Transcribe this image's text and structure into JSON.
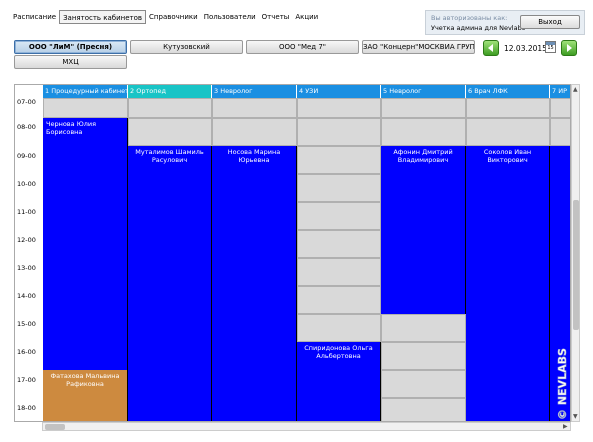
{
  "menu": {
    "items": [
      "Расписание",
      "Занятость кабинетов",
      "Справочники",
      "Пользователи",
      "Отчеты",
      "Акции"
    ]
  },
  "auth": {
    "line1": "Вы авторизованы как:",
    "line2": "Учетка админа для Nevlabs",
    "logout_label": "Выход"
  },
  "branches": {
    "selected": "ООО \"ЛиМ\" (Пресня)",
    "b2": "Кутузовский",
    "b3": "ООО \"Мед 7\"",
    "b4": "ЗАО \"Концерн\"МОСКВИА ГРУПП\"\"",
    "b5": "МХЦ"
  },
  "date": {
    "current": "12.03.2015",
    "calendar_day": "15"
  },
  "schedule": {
    "times": [
      "07-00",
      "08-00",
      "09-00",
      "10-00",
      "11-00",
      "12-00",
      "13-00",
      "14-00",
      "15-00",
      "16-00",
      "17-00",
      "18-00"
    ],
    "columns": [
      "1 Процедурный кабинет",
      "2 Ортопед",
      "3 Невролог",
      "4 УЗИ",
      "5 Невролог",
      "6 Врач ЛФК",
      "7 ИР"
    ],
    "appointments": {
      "a1": "Чернова Юлия Борисовна",
      "a2": "Муталимов Шамиль Расулович",
      "a3": "Носова Марина Юрьевна",
      "a4": "Спиридонова Ольга Альбертовна",
      "a5": "Афонин Дмитрий Владимирович",
      "a6": "Соколов Иван Викторович",
      "a7": "Фатахова Мальвина Рафиковна"
    }
  },
  "colors": {
    "appointment": "#0000ff",
    "appointment_alt": "#cd8a3f",
    "header": "#1a8fe2",
    "header_alt": "#18c4c6",
    "free_slot": "#d9d9d9"
  },
  "icons": [
    "prev-arrow-icon",
    "next-arrow-icon",
    "calendar-icon"
  ],
  "watermark": "© NEVLABS"
}
